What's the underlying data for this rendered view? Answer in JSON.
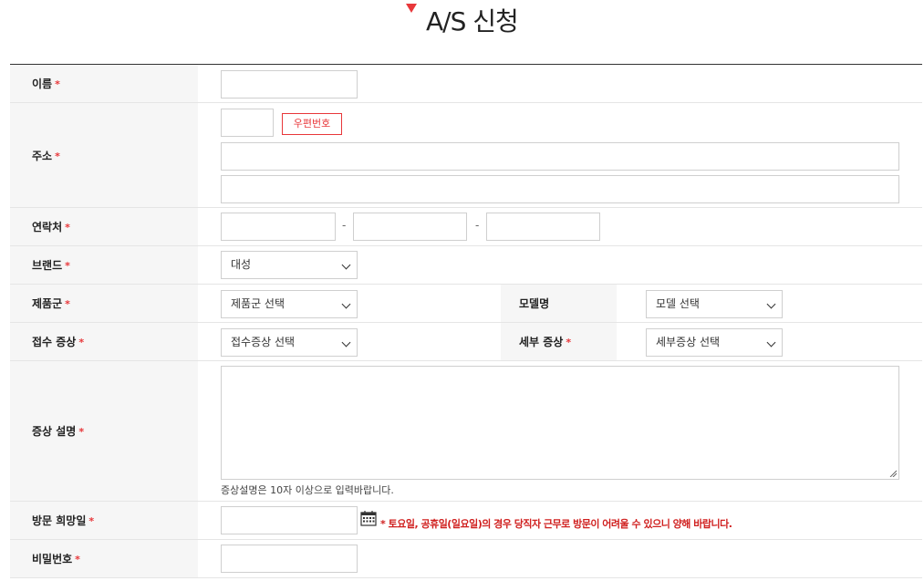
{
  "page": {
    "title": "A/S 신청"
  },
  "labels": {
    "name": "이름",
    "address": "주소",
    "contact": "연락처",
    "brand": "브랜드",
    "product_group": "제품군",
    "model": "모델명",
    "symptom": "접수 증상",
    "detail_symptom": "세부 증상",
    "symptom_desc": "증상 설명",
    "visit_date": "방문 희망일",
    "password": "비밀번호",
    "required_mark": "*"
  },
  "buttons": {
    "zipcode": "우편번호"
  },
  "phone_separator": "-",
  "selects": {
    "brand": "대성",
    "product_group": "제품군 선택",
    "model": "모델 선택",
    "symptom": "접수증상 선택",
    "detail_symptom": "세부증상 선택"
  },
  "notes": {
    "symptom_hint": "증상설명은 10자 이상으로 입력바랍니다.",
    "visit_warning": "* 토요일, 공휴일(일요일)의 경우 당직자 근무로 방문이 어려울 수 있으니 양해 바랍니다."
  },
  "icons": {
    "calendar": "calendar-icon",
    "title_marker": "triangle-marker-icon"
  },
  "colors": {
    "accent": "#e8373a",
    "warning": "#d0201f",
    "label_bg": "#f6f6f6"
  }
}
